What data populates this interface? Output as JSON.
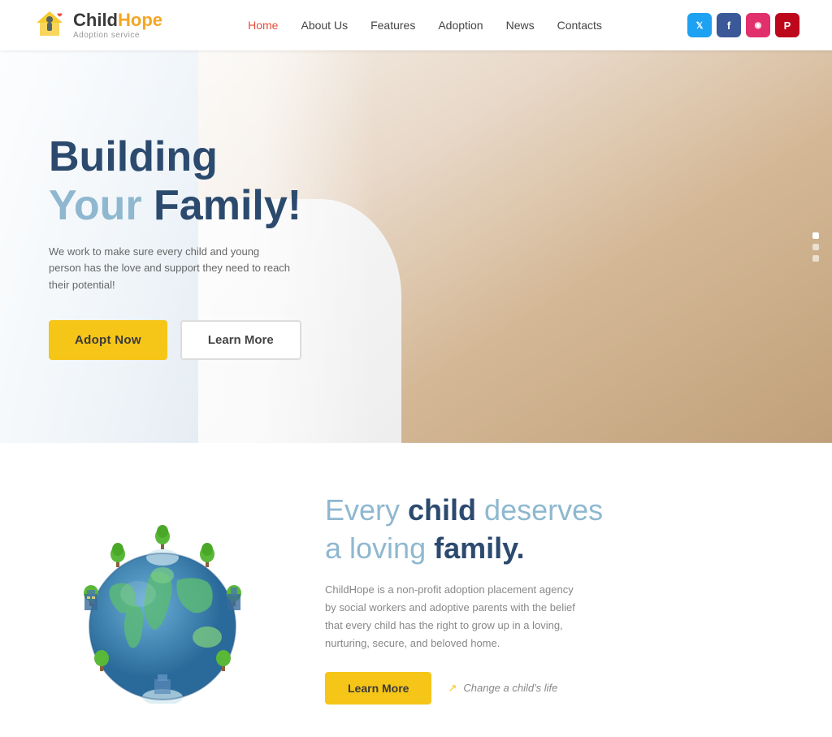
{
  "header": {
    "logo": {
      "name_part1": "Child",
      "name_part2": "Hope",
      "tagline": "Adoption service"
    },
    "nav": [
      {
        "label": "Home",
        "active": true
      },
      {
        "label": "About Us",
        "active": false
      },
      {
        "label": "Features",
        "active": false
      },
      {
        "label": "Adoption",
        "active": false
      },
      {
        "label": "News",
        "active": false
      },
      {
        "label": "Contacts",
        "active": false
      }
    ],
    "social": [
      {
        "id": "twitter",
        "icon": "𝕏",
        "label": "Twitter",
        "color": "#1da1f2"
      },
      {
        "id": "facebook",
        "icon": "f",
        "label": "Facebook",
        "color": "#3b5998"
      },
      {
        "id": "instagram",
        "icon": "◉",
        "label": "Instagram",
        "color": "#e1306c"
      },
      {
        "id": "pinterest",
        "icon": "P",
        "label": "Pinterest",
        "color": "#bd081c"
      }
    ]
  },
  "hero": {
    "title_line1": "Building",
    "title_line2_your": "Your ",
    "title_line2_family": "Family!",
    "subtitle": "We work to make sure every child and young person has the love and support they need to reach their potential!",
    "btn_adopt": "Adopt Now",
    "btn_learn": "Learn More",
    "slider_dots": 3
  },
  "about": {
    "heading_every": "Every ",
    "heading_child": "child",
    "heading_deserves": " deserves",
    "heading_a_loving": "a loving ",
    "heading_family": "family.",
    "description": "ChildHope is a non-profit adoption placement agency by social workers and adoptive parents with the belief that every child has the right to grow up in a loving, nurturing, secure, and beloved home.",
    "btn_learn_more": "Learn More",
    "change_life": "Change a child's life"
  },
  "colors": {
    "primary_blue": "#2c4a6e",
    "light_blue": "#8fb8d0",
    "yellow": "#f5c518",
    "red_nav": "#e74c3c",
    "text_gray": "#888888"
  }
}
